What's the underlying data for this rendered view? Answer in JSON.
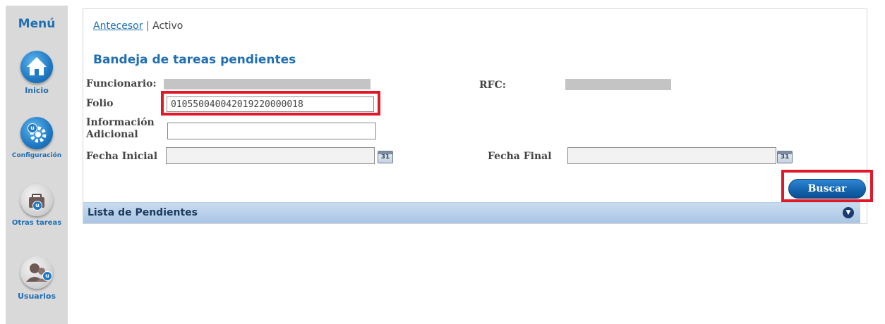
{
  "sidebar": {
    "title": "Menú",
    "items": [
      {
        "label": "Inicio",
        "icon": "home-icon"
      },
      {
        "label": "Configuración",
        "icon": "gear-icon"
      },
      {
        "label": "Otras tareas",
        "icon": "briefcase-icon"
      },
      {
        "label": "Usuarios",
        "icon": "users-icon"
      }
    ]
  },
  "breadcrumb": {
    "link": "Antecesor",
    "separator": "|",
    "current": "Activo"
  },
  "page_title": "Bandeja de tareas pendientes",
  "form": {
    "funcionario_label": "Funcionario:",
    "rfc_label": "RFC:",
    "folio_label": "Folio",
    "folio_value": "010550040042019220000018",
    "info_label_line1": "Información",
    "info_label_line2": "Adicional",
    "info_value": "",
    "fecha_inicial_label": "Fecha Inicial",
    "fecha_inicial_value": "",
    "fecha_final_label": "Fecha Final",
    "fecha_final_value": "",
    "calendar_text": "31"
  },
  "buttons": {
    "buscar": "Buscar"
  },
  "list": {
    "title": "Lista de Pendientes"
  },
  "colors": {
    "accent": "#1f6fb2",
    "highlight": "#e0182a",
    "sidebar_bg": "#d9d9d9"
  }
}
